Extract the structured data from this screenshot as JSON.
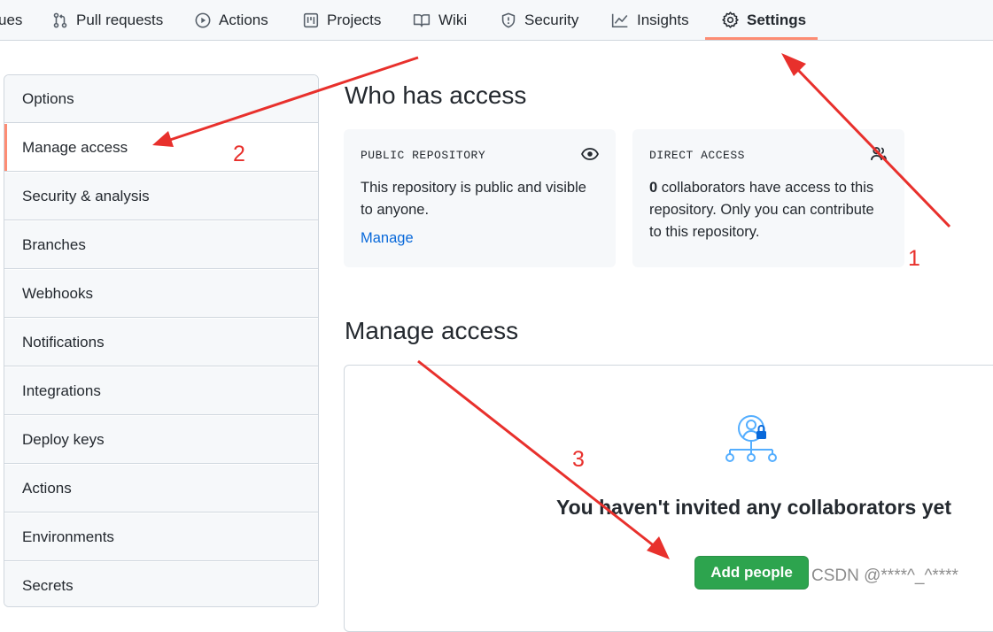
{
  "topnav": {
    "tabs": [
      {
        "label": "ues",
        "icon": "issues-icon"
      },
      {
        "label": "Pull requests",
        "icon": "pull-request-icon"
      },
      {
        "label": "Actions",
        "icon": "play-icon"
      },
      {
        "label": "Projects",
        "icon": "project-icon"
      },
      {
        "label": "Wiki",
        "icon": "book-icon"
      },
      {
        "label": "Security",
        "icon": "shield-icon"
      },
      {
        "label": "Insights",
        "icon": "graph-icon"
      },
      {
        "label": "Settings",
        "icon": "gear-icon",
        "active": true
      }
    ]
  },
  "sidebar": {
    "items": [
      {
        "label": "Options"
      },
      {
        "label": "Manage access",
        "selected": true
      },
      {
        "label": "Security & analysis"
      },
      {
        "label": "Branches"
      },
      {
        "label": "Webhooks"
      },
      {
        "label": "Notifications"
      },
      {
        "label": "Integrations"
      },
      {
        "label": "Deploy keys"
      },
      {
        "label": "Actions"
      },
      {
        "label": "Environments"
      },
      {
        "label": "Secrets"
      }
    ]
  },
  "who_has_access": {
    "title": "Who has access",
    "public_card": {
      "label": "PUBLIC REPOSITORY",
      "body": "This repository is public and visible to anyone.",
      "link": "Manage"
    },
    "direct_card": {
      "label": "DIRECT ACCESS",
      "count": "0",
      "body": " collaborators have access to this repository. Only you can contribute to this repository."
    }
  },
  "manage_access": {
    "title": "Manage access",
    "empty_title": "You haven't invited any collaborators yet",
    "add_button": "Add people"
  },
  "annotations": {
    "one": "1",
    "two": "2",
    "three": "3"
  },
  "watermark": "CSDN @****^_^****",
  "colors": {
    "accent_underline": "#fd8c73",
    "link": "#0969da",
    "primary_button": "#2da44e",
    "annotation": "#e8302c"
  }
}
